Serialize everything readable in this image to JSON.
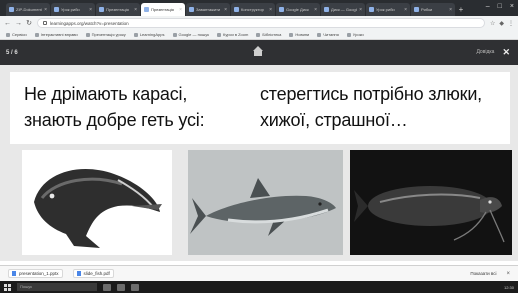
{
  "browser": {
    "tabs": [
      {
        "label": "ZIP-Dokument",
        "active": false
      },
      {
        "label": "Урок риби",
        "active": false
      },
      {
        "label": "Презентація",
        "active": false
      },
      {
        "label": "Презентація",
        "active": true
      },
      {
        "label": "Завантажити",
        "active": false
      },
      {
        "label": "Конструктор",
        "active": false
      },
      {
        "label": "Google Диск",
        "active": false
      },
      {
        "label": "Диск — Google",
        "active": false
      },
      {
        "label": "Урок риби",
        "active": false
      },
      {
        "label": "Рибки",
        "active": false
      }
    ],
    "url": "learningapps.org/watch?v=presentation",
    "bookmarks": [
      "Сервіси",
      "Інтерактивні вправи",
      "Презентація уроку",
      "LearningApps",
      "Google — пошук",
      "Курси в Zoom",
      "Бібліотека",
      "Новини",
      "Читання",
      "Уроки"
    ]
  },
  "header": {
    "slide_counter": "5 / 6",
    "link_label": "Довідка",
    "close_label": "✕"
  },
  "slide": {
    "left_line1": "Не дрімають карасі,",
    "left_line2": "знають добре геть усі:",
    "right_line1": "стерегтись потрібно злюки,",
    "right_line2": "хижої, страшної…"
  },
  "images": [
    {
      "subject": "pike",
      "bg": "#ffffff"
    },
    {
      "subject": "shark",
      "bg": "#bfc3c4"
    },
    {
      "subject": "catfish",
      "bg": "#121212"
    }
  ],
  "downloads": {
    "items": [
      "presentation_1.pptx",
      "slide_fish.pdf"
    ],
    "show_all": "Показати всі"
  },
  "taskbar": {
    "search_placeholder": "Пошук",
    "clock": "12:30"
  }
}
